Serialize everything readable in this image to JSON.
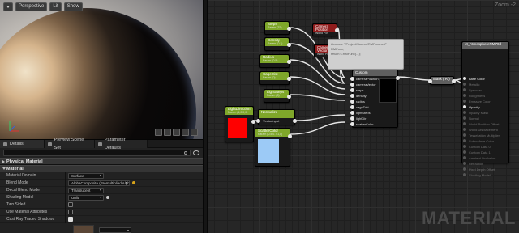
{
  "viewport": {
    "toolbar": {
      "perspective": "Perspective",
      "lit": "Lit",
      "show": "Show"
    }
  },
  "details": {
    "tabs": [
      "Details",
      "Preview Scene Set",
      "Parameter Defaults"
    ],
    "categories": {
      "physical": "Physical Material",
      "material": "Material"
    },
    "properties": [
      {
        "label": "Material Domain",
        "value": "Surface",
        "type": "dropdown"
      },
      {
        "label": "Blend Mode",
        "value": "AlphaComposite (Premultiplied Alpha)",
        "type": "dropdown"
      },
      {
        "label": "Decal Blend Mode",
        "value": "Translucent",
        "type": "dropdown"
      },
      {
        "label": "Shading Model",
        "value": "Unlit",
        "type": "dropdown"
      },
      {
        "label": "Two Sided",
        "value": false,
        "type": "checkbox"
      },
      {
        "label": "Use Material Attributes",
        "value": false,
        "type": "checkbox"
      },
      {
        "label": "Cast Ray Traced Shadows",
        "value": true,
        "type": "checkbox"
      }
    ]
  },
  "graph": {
    "zoom": "Zoom -2",
    "watermark": "MATERIAL",
    "nodes": {
      "steps": {
        "title": "Steps",
        "sub": "Param (32)"
      },
      "density": {
        "title": "Density",
        "sub": "Param (0.1)"
      },
      "radius": {
        "title": "Radius",
        "sub": "Param (0.5)"
      },
      "cage_dist": {
        "title": "CageDist",
        "sub": "Param (0)"
      },
      "light_steps": {
        "title": "LightSteps",
        "sub": "Param (8)"
      },
      "light_direction": {
        "title": "LightDirection",
        "sub": "Param (1,0,0,0)"
      },
      "normalize": {
        "title": "Normalize",
        "sub": "",
        "pin": "VectorInput"
      },
      "scatter_color": {
        "title": "ScatterColor",
        "sub": "Param (0.5,0.7,1,0)"
      },
      "camera_position": {
        "title": "Camera Position",
        "sub": "World Pos"
      },
      "camera_vector": {
        "title": "Camera Vector",
        "sub": "World Pos"
      },
      "custom": {
        "title": "Custom",
        "pins": [
          "cameraPosition",
          "cameraVector",
          "steps",
          "density",
          "radius",
          "cageDist",
          "lightSteps",
          "lightDir",
          "scatterColor"
        ]
      },
      "mask": {
        "title": "Mask ( R )"
      },
      "result": {
        "title": "M_AtmosphereRM70d",
        "pins": [
          "Base Color",
          "Metallic",
          "Specular",
          "Roughness",
          "Emissive Color",
          "Opacity",
          "Opacity Mask",
          "Normal",
          "World Position Offset",
          "World Displacement",
          "Tessellation Multiplier",
          "Subsurface Color",
          "Custom Data 0",
          "Custom Data 1",
          "Ambient Occlusion",
          "Refraction",
          "Pixel Depth Offset",
          "Shading Model"
        ]
      }
    },
    "comment_text": [
      "#include \"/Project/Source/RMFunc.usf\"",
      "RMFunc;",
      "return s.RMFunc(...);"
    ],
    "colors": {
      "light_direction": "#ff0000",
      "scatter_color": "#9ccaf6"
    }
  }
}
